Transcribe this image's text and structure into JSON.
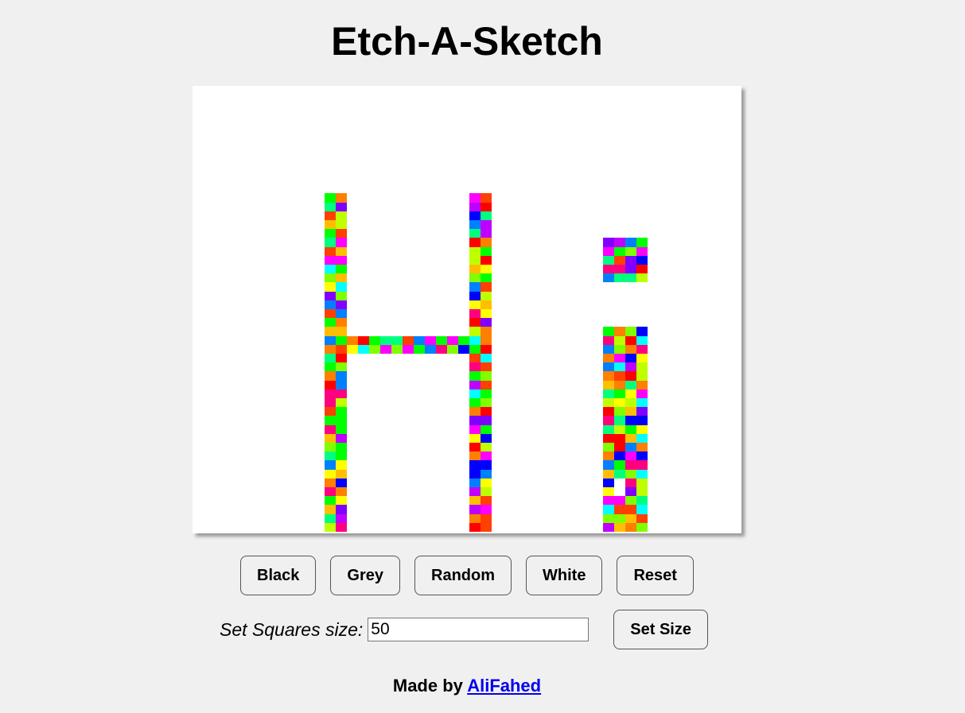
{
  "title": "Etch-A-Sketch",
  "board": {
    "grid_size": 50,
    "background": "#ffffff",
    "palette": [
      "#ff0000",
      "#ff4000",
      "#ff8000",
      "#ffbf00",
      "#ffff00",
      "#bfff00",
      "#80ff00",
      "#00ff00",
      "#00ff80",
      "#00ffff",
      "#0080ff",
      "#0000ff",
      "#8000ff",
      "#bf00ff",
      "#ff00ff",
      "#ff0080"
    ]
  },
  "buttons": {
    "black": "Black",
    "grey": "Grey",
    "random": "Random",
    "white": "White",
    "reset": "Reset"
  },
  "size_form": {
    "label": "Set Squares size:",
    "value": "50",
    "button": "Set Size"
  },
  "footer": {
    "prefix": "Made by",
    "author": "AliFahed"
  }
}
